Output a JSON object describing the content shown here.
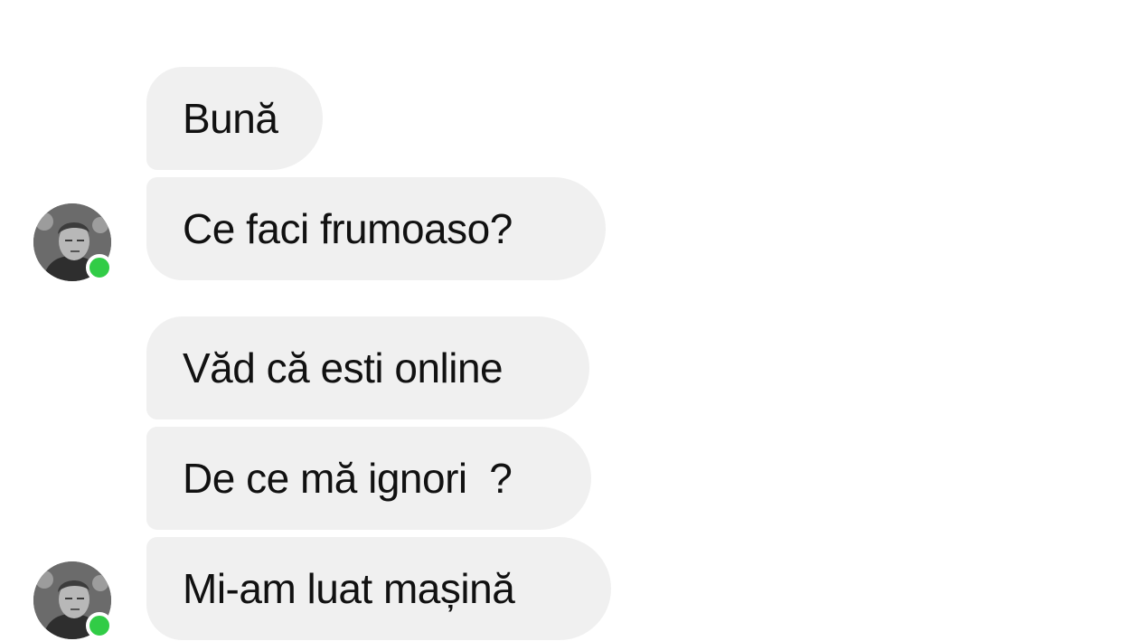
{
  "conversation": {
    "messages": [
      {
        "text": "Bună"
      },
      {
        "text": "Ce faci frumoaso?"
      },
      {
        "text": "Văd că esti online"
      },
      {
        "text": "De ce mă ignori  ?"
      },
      {
        "text": "Mi-am luat mașină"
      }
    ],
    "avatar_icon": "user-avatar-icon",
    "presence": {
      "status_icon": "online-status-icon",
      "color": "#31cc46"
    },
    "bubble_color": "#f0f0f0",
    "text_color": "#111111"
  }
}
